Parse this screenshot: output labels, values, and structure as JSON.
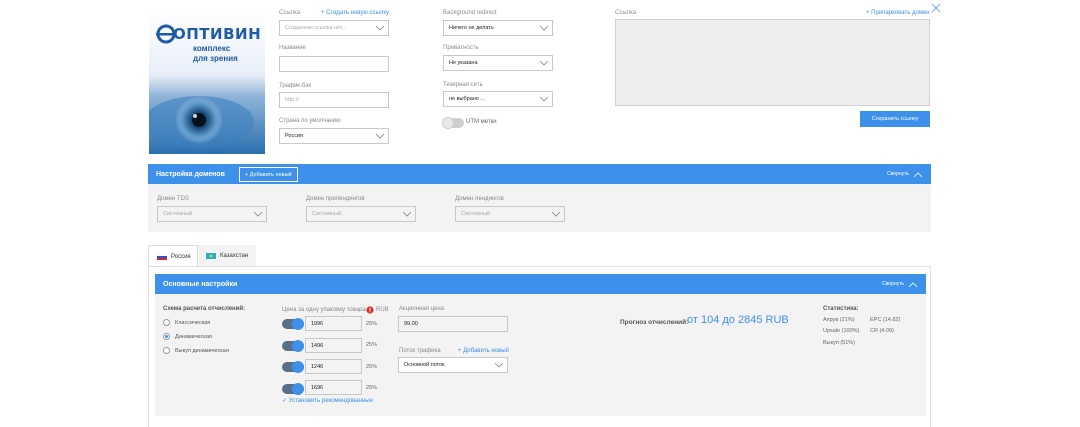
{
  "logo": {
    "brand": "ОПТИВИН",
    "sub1": "комплекс",
    "sub2": "для зрения"
  },
  "form": {
    "link_label": "Ссылка",
    "create_link": "+ Создать новую ссылку",
    "link_value": "Созданная ссылка нет...",
    "name_label": "Название",
    "name_value": "",
    "traffic_label": "Трафик-бэк",
    "traffic_placeholder": "http://",
    "country_label": "Страна по умолчанию",
    "country_value": "Россия",
    "redirect_label": "Background redirect",
    "redirect_value": "Ничего не делать",
    "privacy_label": "Приватность",
    "privacy_value": "Не указана",
    "teaser_label": "Тизерная сеть",
    "teaser_value": "не выбрано ...",
    "utm_label": "UTM метки",
    "right_link_label": "Ссылка",
    "park_domain": "+ Припарковать домен",
    "save_button": "Сохранить ссылку"
  },
  "domains": {
    "title": "Настройка доменов",
    "add_new": "+ Добавить новый",
    "collapse": "Свернуть",
    "tds_label": "Домен TDS",
    "tds_value": "Системный",
    "prelanding_label": "Домен прелендингов",
    "prelanding_value": "Системный",
    "landing_label": "Домен лендингов",
    "landing_value": "Системный"
  },
  "tabs": [
    {
      "label": "Россия"
    },
    {
      "label": "Казахстан"
    }
  ],
  "main": {
    "title": "Основные настройки",
    "collapse": "Свернуть",
    "scheme_label": "Схема расчета отчислений:",
    "scheme_options": [
      "Классическая",
      "Динамическая",
      "Выкуп динамическая"
    ],
    "price_label": "Цена за одну упаковку товара в",
    "price_currency": "RUB",
    "prices": [
      {
        "value": "1996",
        "pct": "25%"
      },
      {
        "value": "1496",
        "pct": "25%"
      },
      {
        "value": "1246",
        "pct": "25%"
      },
      {
        "value": "1696",
        "pct": "25%"
      }
    ],
    "recommended": "✓ Установить рекомендованные",
    "promo_label": "Акционная цена",
    "promo_value": "99.00",
    "flow_label": "Поток трафика",
    "add_new": "+ Добавить новый",
    "flow_value": "Основной поток",
    "forecast_label": "Прогноз отчислений:",
    "forecast_value": "от 104 до 2845 RUB",
    "stats_title": "Статистика:",
    "stats": [
      {
        "text": "Апрув (21%)"
      },
      {
        "text": "EPC (14.82)"
      },
      {
        "text": "Upsale (100%)"
      },
      {
        "text": "CR (4.09)"
      },
      {
        "text": "Выкуп (51%)"
      }
    ]
  },
  "colors": {
    "accent": "#3e91ea",
    "panel": "#f3f3f3"
  }
}
